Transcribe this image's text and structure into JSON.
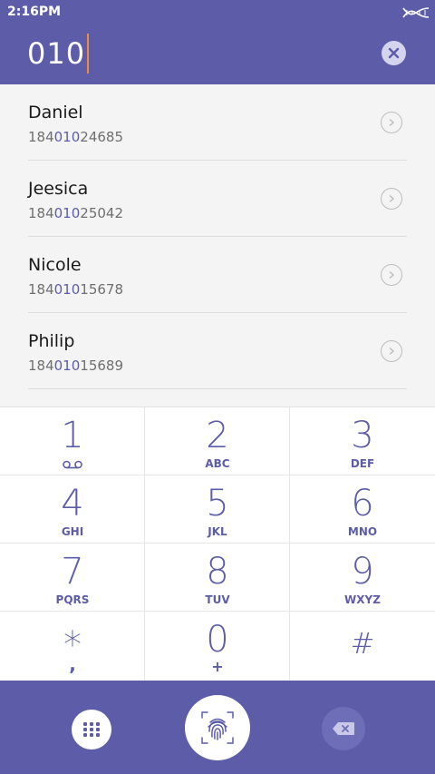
{
  "status_bar": {
    "time": "2:16PM"
  },
  "search": {
    "query": "010"
  },
  "contacts": [
    {
      "name": "Daniel",
      "number_prefix": "184",
      "number_match": "010",
      "number_suffix": "24685"
    },
    {
      "name": "Jeesica",
      "number_prefix": "184",
      "number_match": "010",
      "number_suffix": "25042"
    },
    {
      "name": "Nicole",
      "number_prefix": "184",
      "number_match": "010",
      "number_suffix": "15678"
    },
    {
      "name": "Philip",
      "number_prefix": "184",
      "number_match": "010",
      "number_suffix": "15689"
    }
  ],
  "dialpad": {
    "keys": [
      {
        "digit": "1",
        "sub": ""
      },
      {
        "digit": "2",
        "sub": "ABC"
      },
      {
        "digit": "3",
        "sub": "DEF"
      },
      {
        "digit": "4",
        "sub": "GHI"
      },
      {
        "digit": "5",
        "sub": "JKL"
      },
      {
        "digit": "6",
        "sub": "MNO"
      },
      {
        "digit": "7",
        "sub": "PQRS"
      },
      {
        "digit": "8",
        "sub": "TUV"
      },
      {
        "digit": "9",
        "sub": "WXYZ"
      },
      {
        "digit": "*",
        "sub": ","
      },
      {
        "digit": "0",
        "sub": "+"
      },
      {
        "digit": "#",
        "sub": ""
      }
    ]
  },
  "icons": {
    "status": "dna-icon",
    "clear": "close-icon",
    "row_action": "chevron-right-icon",
    "voicemail": "voicemail-icon",
    "dialpad_toggle": "grid-icon",
    "call": "fingerprint-icon",
    "backspace": "backspace-icon"
  },
  "colors": {
    "primary": "#5d5ca8",
    "highlight": "#5d5ca8",
    "caret": "#f08a3c",
    "background": "#f4f4f4"
  }
}
